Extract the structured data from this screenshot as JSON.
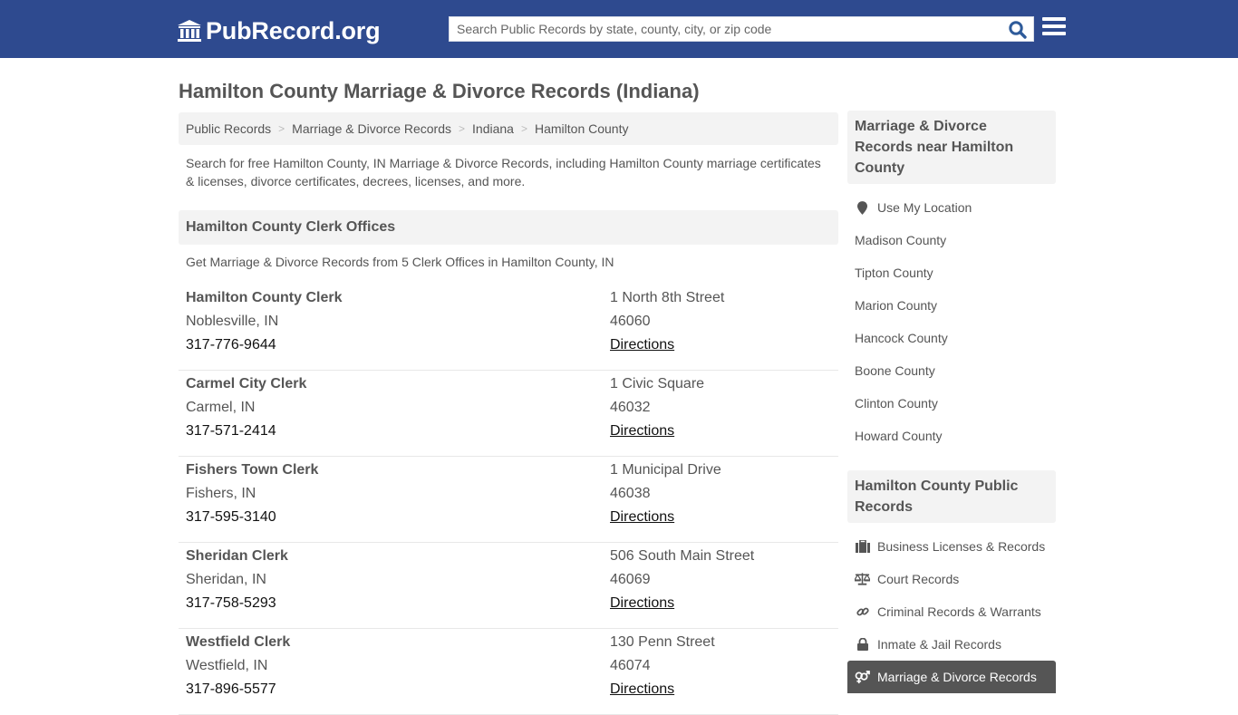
{
  "header": {
    "logo_text": "PubRecord.org",
    "search_placeholder": "Search Public Records by state, county, city, or zip code",
    "search_value": "",
    "brand_color": "#2e4a8f"
  },
  "page": {
    "title": "Hamilton County Marriage & Divorce Records (Indiana)",
    "breadcrumb": [
      "Public Records",
      "Marriage & Divorce Records",
      "Indiana",
      "Hamilton County"
    ],
    "intro": "Search for free Hamilton County, IN Marriage & Divorce Records, including Hamilton County marriage certificates & licenses, divorce certificates, decrees, licenses, and more."
  },
  "clerk_section": {
    "heading": "Hamilton County Clerk Offices",
    "subtext": "Get Marriage & Divorce Records from 5 Clerk Offices in Hamilton County, IN",
    "offices": [
      {
        "name": "Hamilton County Clerk",
        "city": "Noblesville, IN",
        "phone": "317-776-9644",
        "street": "1 North 8th Street",
        "zip": "46060",
        "directions": "Directions"
      },
      {
        "name": "Carmel City Clerk",
        "city": "Carmel, IN",
        "phone": "317-571-2414",
        "street": "1 Civic Square",
        "zip": "46032",
        "directions": "Directions"
      },
      {
        "name": "Fishers Town Clerk",
        "city": "Fishers, IN",
        "phone": "317-595-3140",
        "street": "1 Municipal Drive",
        "zip": "46038",
        "directions": "Directions"
      },
      {
        "name": "Sheridan Clerk",
        "city": "Sheridan, IN",
        "phone": "317-758-5293",
        "street": "506 South Main Street",
        "zip": "46069",
        "directions": "Directions"
      },
      {
        "name": "Westfield Clerk",
        "city": "Westfield, IN",
        "phone": "317-896-5577",
        "street": "130 Penn Street",
        "zip": "46074",
        "directions": "Directions"
      }
    ]
  },
  "sidebar": {
    "nearby_heading": "Marriage & Divorce Records near Hamilton County",
    "use_location": "Use My Location",
    "nearby": [
      "Madison County",
      "Tipton County",
      "Marion County",
      "Hancock County",
      "Boone County",
      "Clinton County",
      "Howard County"
    ],
    "public_heading": "Hamilton County Public Records",
    "categories": [
      {
        "label": "Business Licenses & Records",
        "icon": "briefcase-icon"
      },
      {
        "label": "Court Records",
        "icon": "scales-icon"
      },
      {
        "label": "Criminal Records & Warrants",
        "icon": "link-icon"
      },
      {
        "label": "Inmate & Jail Records",
        "icon": "lock-icon"
      },
      {
        "label": "Marriage & Divorce Records",
        "icon": "gender-icon",
        "active": true
      }
    ]
  }
}
